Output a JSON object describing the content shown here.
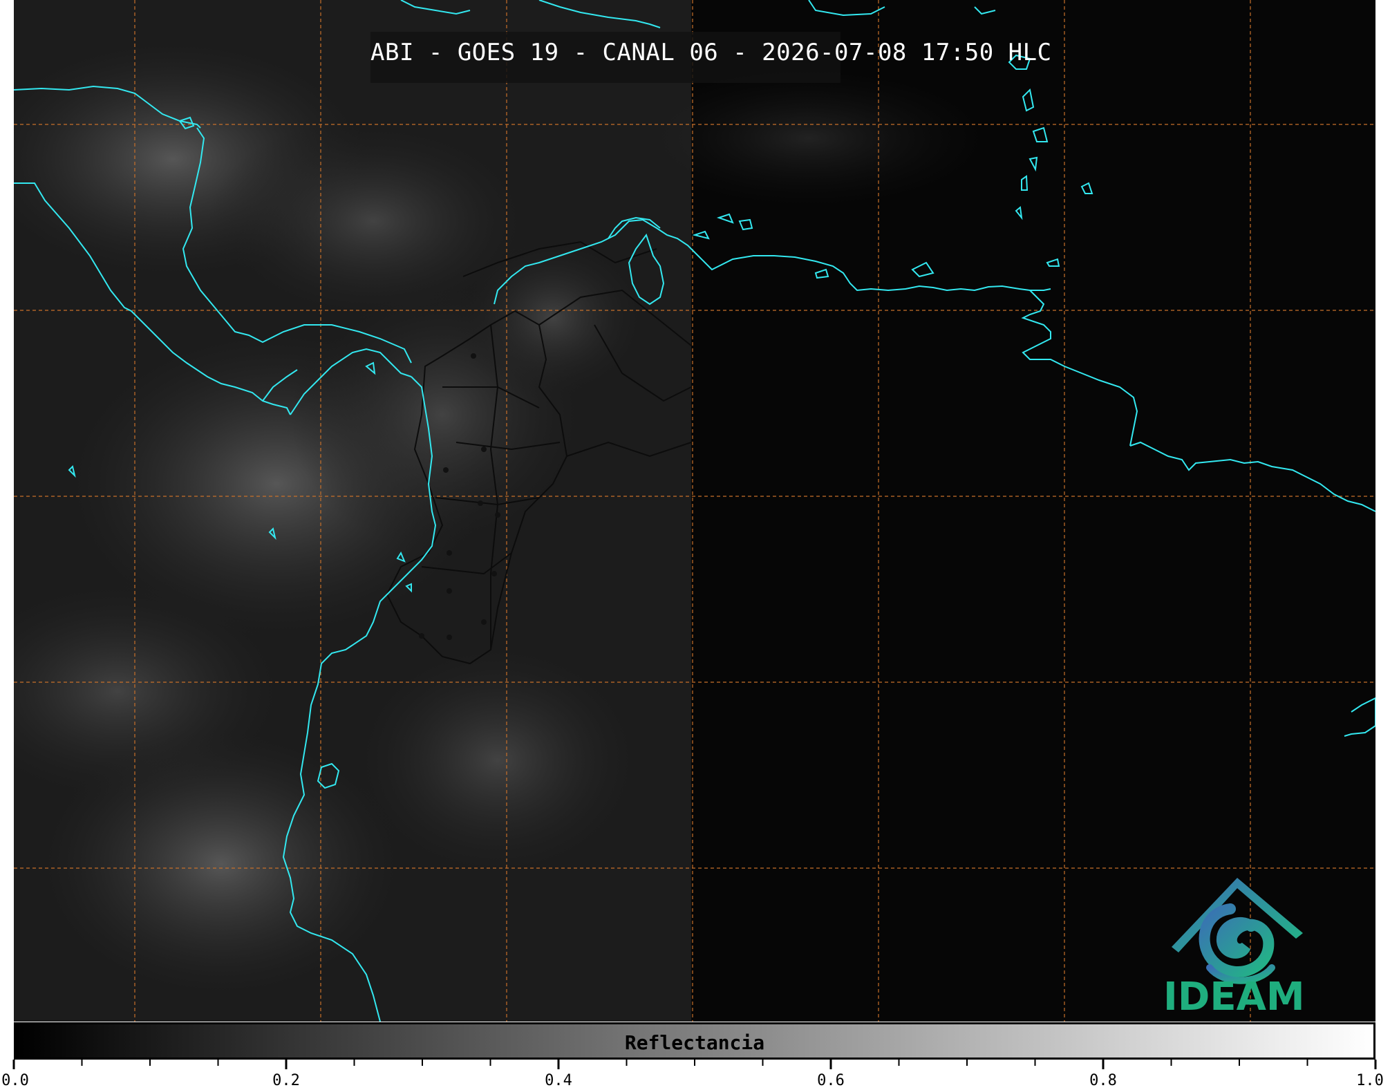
{
  "map": {
    "title": "ABI - GOES 19 - CANAL 06 - 2026-07-08 17:50 HLC",
    "background_color": "#060606",
    "coastline_color": "#33e8f0",
    "grid_color": "#c8702a",
    "border_color": "#111111"
  },
  "logo": {
    "text": "IDEAM",
    "name": "ideam-logo"
  },
  "colorbar": {
    "label": "Reflectancia",
    "min": 0.0,
    "max": 1.0,
    "ticks": [
      "0.0",
      "0.2",
      "0.4",
      "0.6",
      "0.8",
      "1.0"
    ]
  }
}
